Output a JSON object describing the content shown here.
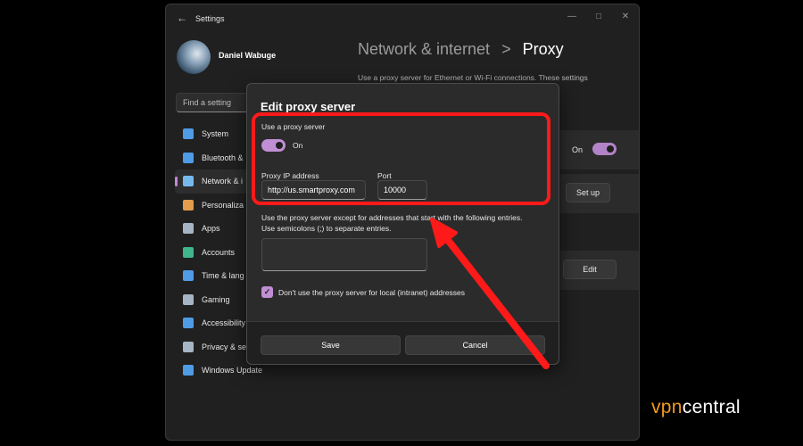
{
  "window": {
    "title": "Settings",
    "back_icon": "back-arrow-icon",
    "controls": [
      "minimize-icon",
      "maximize-icon",
      "close-icon"
    ]
  },
  "user": {
    "name": "Daniel Wabuge"
  },
  "search": {
    "placeholder": "Find a setting"
  },
  "sidebar": {
    "items": [
      {
        "label": "System",
        "icon": "monitor-icon",
        "color": "#4f9be6"
      },
      {
        "label": "Bluetooth &",
        "icon": "bluetooth-icon",
        "color": "#4f9be6"
      },
      {
        "label": "Network & i",
        "icon": "wifi-icon",
        "color": "#76b9ed",
        "active": true
      },
      {
        "label": "Personaliza",
        "icon": "brush-icon",
        "color": "#e29c4b"
      },
      {
        "label": "Apps",
        "icon": "apps-icon",
        "color": "#a6b5c4"
      },
      {
        "label": "Accounts",
        "icon": "person-icon",
        "color": "#3fb68b"
      },
      {
        "label": "Time & lang",
        "icon": "globe-clock-icon",
        "color": "#4f9be6"
      },
      {
        "label": "Gaming",
        "icon": "gamepad-icon",
        "color": "#a6b5c4"
      },
      {
        "label": "Accessibility",
        "icon": "accessibility-icon",
        "color": "#4f9be6"
      },
      {
        "label": "Privacy & se",
        "icon": "shield-icon",
        "color": "#a6b5c4"
      },
      {
        "label": "Windows Update",
        "icon": "update-icon",
        "color": "#4f9be6"
      }
    ]
  },
  "page": {
    "breadcrumb_parent": "Network & internet",
    "breadcrumb_separator": ">",
    "breadcrumb_current": "Proxy",
    "description": "Use a proxy server for Ethernet or Wi-Fi connections. These settings"
  },
  "background": {
    "toggle_label": "On",
    "setup_button": "Set up",
    "edit_button": "Edit"
  },
  "dialog": {
    "title": "Edit proxy server",
    "use_proxy_label": "Use a proxy server",
    "toggle_state": "On",
    "ip_label": "Proxy IP address",
    "ip_value": "http://us.smartproxy.com",
    "port_label": "Port",
    "port_value": "10000",
    "exceptions_line1": "Use the proxy server except for addresses that start with the following entries.",
    "exceptions_line2": "Use semicolons (;) to separate entries.",
    "local_checkbox_label": "Don't use the proxy server for local (intranet) addresses",
    "local_checked": true,
    "save_label": "Save",
    "cancel_label": "Cancel"
  },
  "annotation": {
    "highlight_color": "#ff1a1a"
  },
  "watermark": {
    "part1": "vpn",
    "part2": "central"
  }
}
